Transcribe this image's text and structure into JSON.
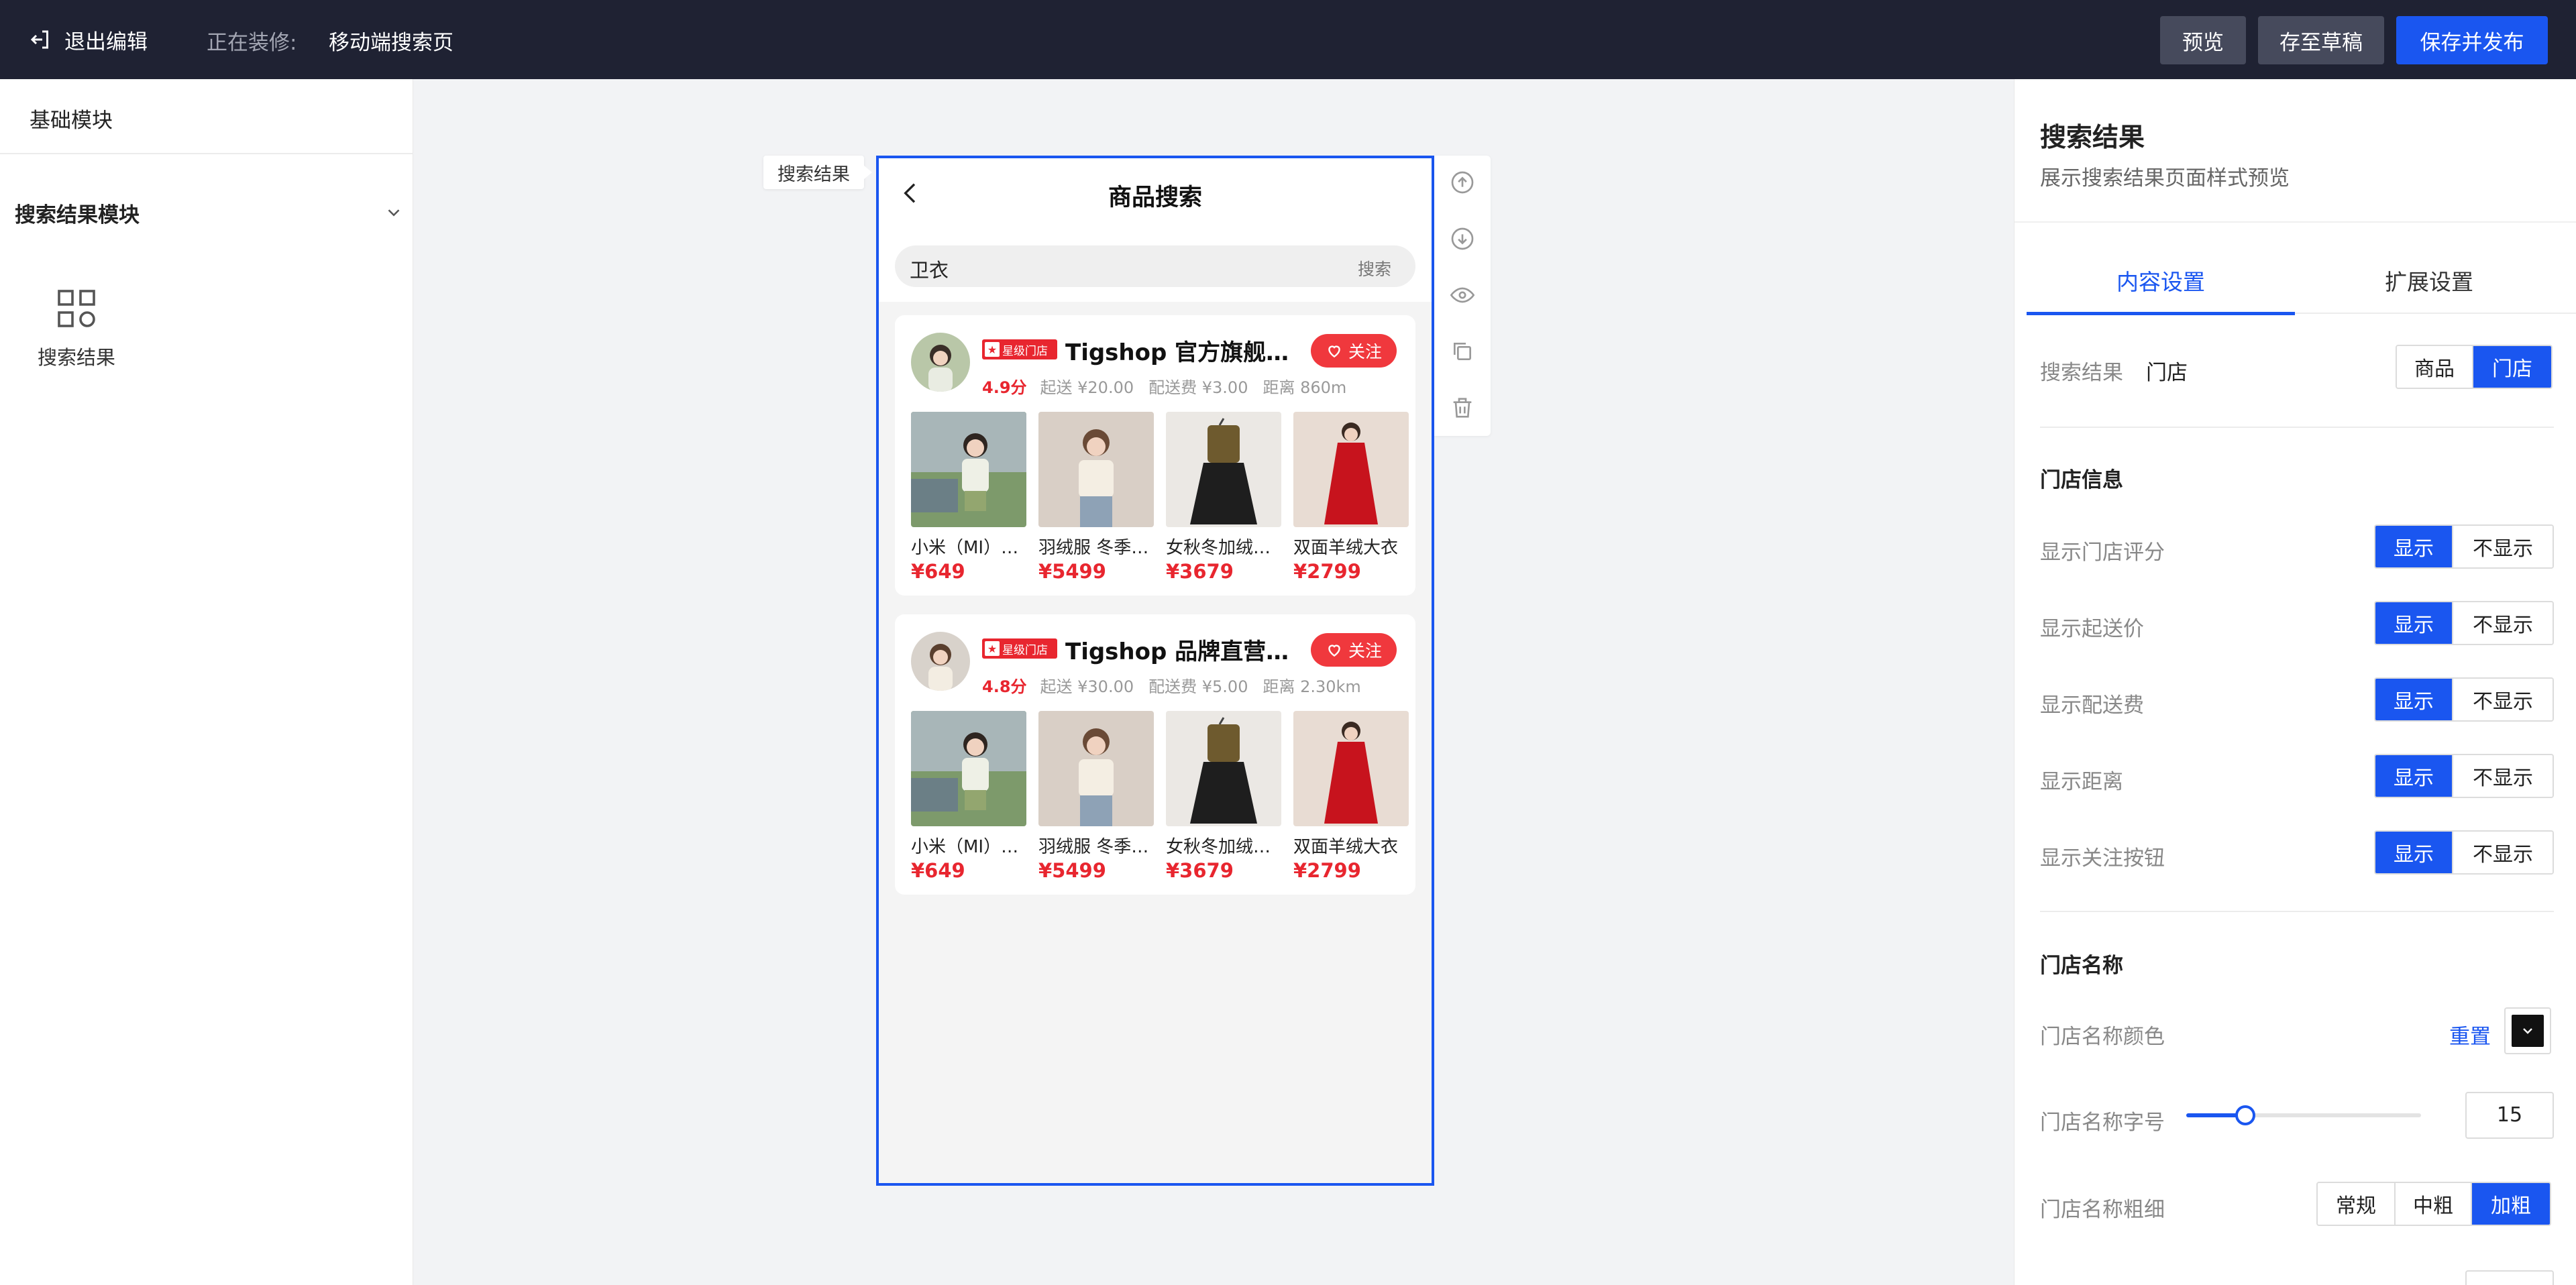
{
  "topbar": {
    "exit_label": "退出编辑",
    "editing_label": "正在装修:",
    "editing_page": "移动端搜索页",
    "preview": "预览",
    "save_draft": "存至草稿",
    "publish": "保存并发布"
  },
  "left": {
    "title": "基础模块",
    "group_label": "搜索结果模块",
    "item_label": "搜索结果"
  },
  "canvas": {
    "tag": "搜索结果",
    "phone_title": "商品搜索",
    "search_value": "卫衣",
    "search_button": "搜索",
    "stores": [
      {
        "badge": "星级门店",
        "name": "Tigshop 官方旗舰门店",
        "follow": "关注",
        "score": "4.9分",
        "min_order": "起送 ¥20.00",
        "delivery_fee": "配送费 ¥3.00",
        "distance": "距离 860m",
        "goods": [
          {
            "name": "小米（MI）卫衣",
            "price": "¥649"
          },
          {
            "name": "羽绒服 冬季外套",
            "price": "¥5499"
          },
          {
            "name": "女秋冬加绒裙装",
            "price": "¥3679"
          },
          {
            "name": "双面羊绒大衣",
            "price": "¥2799"
          }
        ]
      },
      {
        "badge": "星级门店",
        "name": "Tigshop 品牌直营店铺",
        "follow": "关注",
        "score": "4.8分",
        "min_order": "起送 ¥30.00",
        "delivery_fee": "配送费 ¥5.00",
        "distance": "距离 2.30km",
        "goods": [
          {
            "name": "小米（MI）卫衣",
            "price": "¥649"
          },
          {
            "name": "羽绒服 冬季外套",
            "price": "¥5499"
          },
          {
            "name": "女秋冬加绒裙装",
            "price": "¥3679"
          },
          {
            "name": "双面羊绒大衣",
            "price": "¥2799"
          }
        ]
      }
    ]
  },
  "right": {
    "title": "搜索结果",
    "subtitle": "展示搜索结果页面样式预览",
    "tab_content": "内容设置",
    "tab_extend": "扩展设置",
    "result_label": "搜索结果",
    "result_value": "门店",
    "opt_goods": "商品",
    "opt_store": "门店",
    "store_info_title": "门店信息",
    "show": "显示",
    "hide": "不显示",
    "toggles": [
      {
        "label": "显示门店评分",
        "value": "显示"
      },
      {
        "label": "显示起送价",
        "value": "显示"
      },
      {
        "label": "显示配送费",
        "value": "显示"
      },
      {
        "label": "显示距离",
        "value": "显示"
      },
      {
        "label": "显示关注按钮",
        "value": "显示"
      }
    ],
    "store_name_title": "门店名称",
    "name_color_label": "门店名称颜色",
    "reset": "重置",
    "name_color": "#111111",
    "font_size_label": "门店名称字号",
    "font_size": "15",
    "font_size_fraction": 0.25,
    "weight_label": "门店名称粗细",
    "weight_options": [
      "常规",
      "中粗",
      "加粗"
    ],
    "weight_selected": "加粗"
  },
  "colors": {
    "topbar_bg": "#1f2233",
    "accent": "#1a56f0",
    "price_red": "#e8262f"
  }
}
